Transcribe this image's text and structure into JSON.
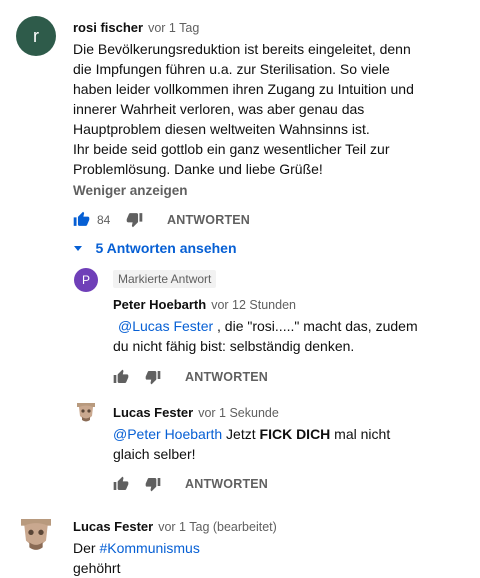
{
  "comment1": {
    "avatar_letter": "r",
    "avatar_color": "#2e5b4a",
    "author": "rosi fischer",
    "time": "vor 1 Tag",
    "lines": [
      "Die Bevölkerungsreduktion ist bereits eingeleitet, denn",
      "die Impfungen führen u.a. zur Sterilisation. So viele",
      "haben leider vollkommen ihren Zugang zu Intuition und",
      "innerer Wahrheit verloren, was aber genau das",
      "Hauptproblem diesen weltweiten Wahnsinns ist.",
      "Ihr beide seid gottlob ein ganz wesentlicher Teil zur",
      "Problemlösung. Danke und liebe Grüße!"
    ],
    "show_less": "Weniger anzeigen",
    "like_count": "84",
    "reply_label": "ANTWORTEN"
  },
  "replies_toggle": "5 Antworten ansehen",
  "reply1": {
    "avatar_letter": "P",
    "avatar_color": "#6f3fb8",
    "badge": "Markierte Antwort",
    "author": "Peter Hoebarth",
    "time": "vor 12 Stunden",
    "mention": "@Lucas Fester",
    "line1_rest": " , die \"rosi.....\" macht das, zudem",
    "line2": "du nicht fähig bist: selbständig denken.",
    "reply_label": "ANTWORTEN"
  },
  "reply2": {
    "author": "Lucas Fester",
    "time": "vor 1 Sekunde",
    "mention": "@Peter Hoebarth",
    "line1_plain": " Jetzt ",
    "line1_bold": "FICK DICH",
    "line1_end": " mal nicht",
    "line2": "glaich selber!",
    "reply_label": "ANTWORTEN"
  },
  "comment2": {
    "author": "Lucas Fester",
    "time": "vor 1 Tag (bearbeitet)",
    "text_prefix": "Der ",
    "hashtag": "#Kommunismus",
    "line2": "gehöhrt"
  }
}
